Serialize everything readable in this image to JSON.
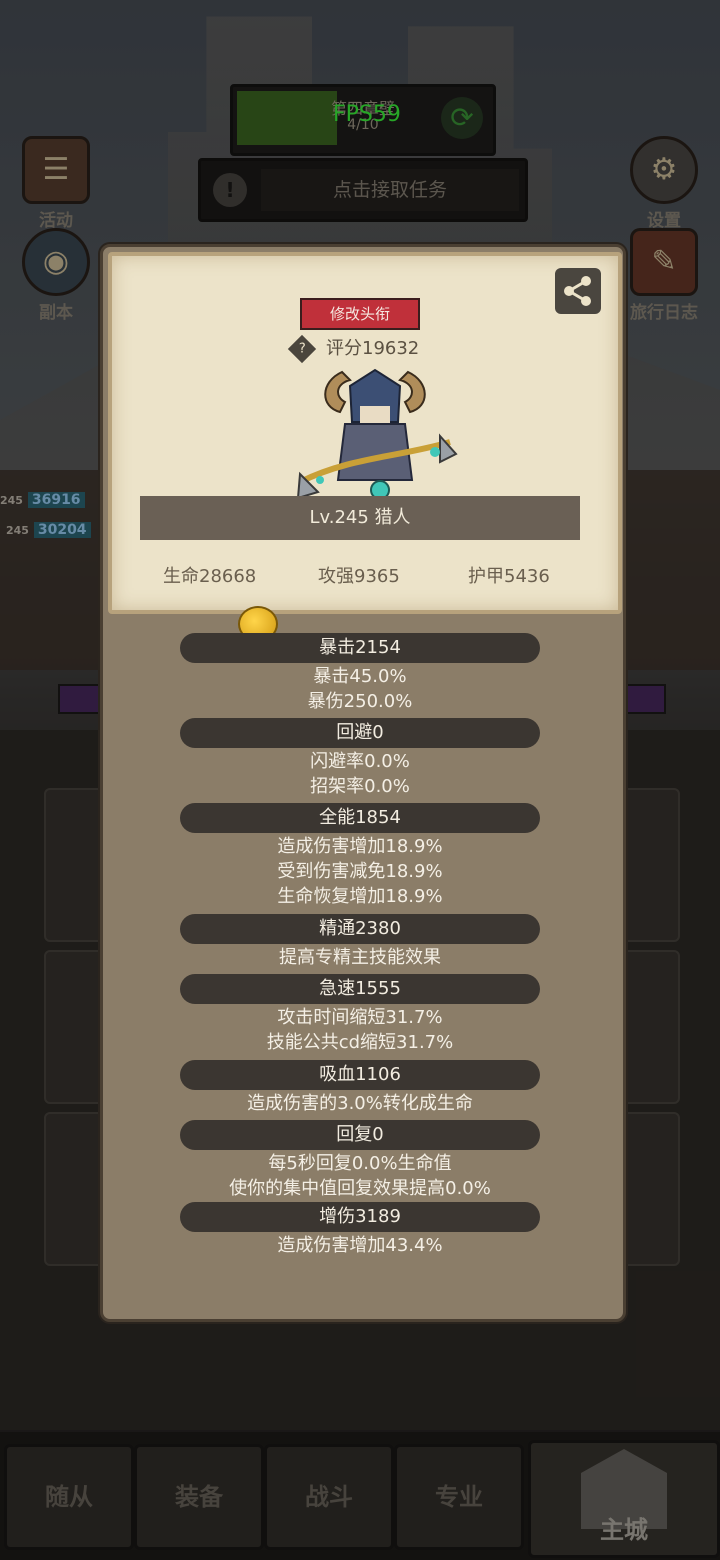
{
  "hud": {
    "quest_title": "第四章壁",
    "quest_progress": "4/10",
    "fps": "FPS59",
    "task_text": "点击接取任务",
    "left_buttons": [
      {
        "label": "活动",
        "icon": "event-book-icon"
      },
      {
        "label": "副本",
        "icon": "dungeon-portal-icon"
      }
    ],
    "right_buttons": [
      {
        "label": "设置",
        "icon": "gear-icon"
      },
      {
        "label": "旅行日志",
        "icon": "journal-icon"
      }
    ],
    "hp_rows": [
      {
        "level": "245",
        "value": "36916"
      },
      {
        "level": "245",
        "value": "30204"
      }
    ]
  },
  "profile": {
    "change_title_label": "修改头衔",
    "score": "评分19632",
    "level_class": "Lv.245 猎人",
    "base_stats": [
      "生命28668",
      "攻强9365",
      "护甲5436"
    ]
  },
  "stats": [
    {
      "head": "暴击2154",
      "lines": [
        "暴击45.0%",
        "暴伤250.0%"
      ]
    },
    {
      "head": "回避0",
      "lines": [
        "闪避率0.0%",
        "招架率0.0%"
      ]
    },
    {
      "head": "全能1854",
      "lines": [
        "造成伤害增加18.9%",
        "受到伤害减免18.9%",
        "生命恢复增加18.9%"
      ]
    },
    {
      "head": "精通2380",
      "lines": [
        "提高专精主技能效果"
      ]
    },
    {
      "head": "急速1555",
      "lines": [
        "攻击时间缩短31.7%",
        "技能公共cd缩短31.7%"
      ]
    },
    {
      "head": "吸血1106",
      "lines": [
        "造成伤害的3.0%转化成生命"
      ]
    },
    {
      "head": "回复0",
      "lines": [
        "每5秒回复0.0%生命值",
        "使你的集中值回复效果提高0.0%"
      ]
    },
    {
      "head": "增伤3189",
      "lines": [
        "造成伤害增加43.4%"
      ]
    }
  ],
  "bottom_nav": [
    "随从",
    "装备",
    "战斗",
    "专业",
    "主城"
  ],
  "colors": {
    "popup_bg": "#8b7d68",
    "parchment": "#ece3c9",
    "title_button": "#c0303a",
    "stat_header": "#3b3631",
    "fps_green": "#3dff3d"
  }
}
